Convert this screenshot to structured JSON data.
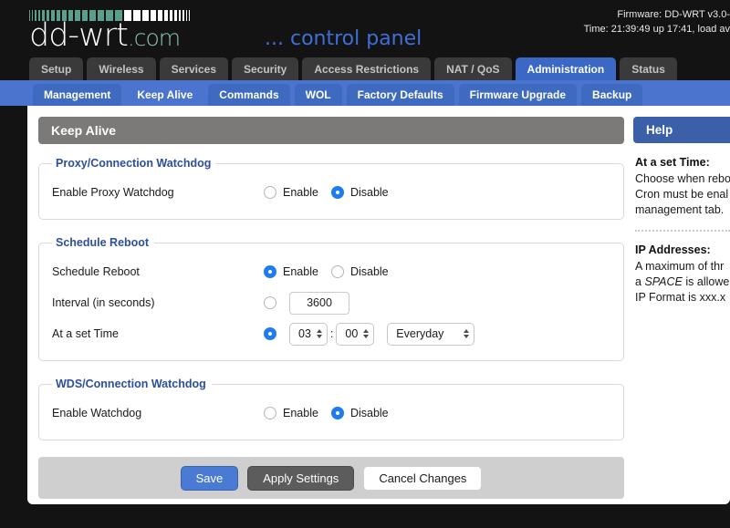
{
  "brand": {
    "logo_main": "dd-wrt",
    "logo_suffix": ".com",
    "tagline": "... control panel",
    "strip_color_teal": "#5c9e8c",
    "strip_color_white": "#ffffff"
  },
  "status": {
    "firmware_line": "Firmware: DD-WRT v3.0-",
    "time_line": "Time: 21:39:49 up 17:41, load av"
  },
  "main_tabs": [
    {
      "label": "Setup",
      "active": false
    },
    {
      "label": "Wireless",
      "active": false
    },
    {
      "label": "Services",
      "active": false
    },
    {
      "label": "Security",
      "active": false
    },
    {
      "label": "Access Restrictions",
      "active": false
    },
    {
      "label": "NAT / QoS",
      "active": false
    },
    {
      "label": "Administration",
      "active": true
    },
    {
      "label": "Status",
      "active": false
    }
  ],
  "sub_tabs": [
    {
      "label": "Management",
      "active": false
    },
    {
      "label": "Keep Alive",
      "active": true
    },
    {
      "label": "Commands",
      "active": false
    },
    {
      "label": "WOL",
      "active": false
    },
    {
      "label": "Factory Defaults",
      "active": false
    },
    {
      "label": "Firmware Upgrade",
      "active": false
    },
    {
      "label": "Backup",
      "active": false
    }
  ],
  "page_title": "Keep Alive",
  "groups": {
    "proxy": {
      "legend": "Proxy/Connection Watchdog",
      "row_label": "Enable Proxy Watchdog",
      "enable_label": "Enable",
      "disable_label": "Disable",
      "selected": "Disable"
    },
    "schedule": {
      "legend": "Schedule Reboot",
      "reboot_label": "Schedule Reboot",
      "enable_label": "Enable",
      "disable_label": "Disable",
      "reboot_selected": "Enable",
      "interval_label": "Interval (in seconds)",
      "interval_value": "3600",
      "interval_selected": false,
      "time_label": "At a set Time",
      "time_selected": true,
      "hour": "03",
      "minute": "00",
      "colon": ":",
      "day": "Everyday"
    },
    "wds": {
      "legend": "WDS/Connection Watchdog",
      "row_label": "Enable Watchdog",
      "enable_label": "Enable",
      "disable_label": "Disable",
      "selected": "Disable"
    }
  },
  "buttons": {
    "save": "Save",
    "apply": "Apply Settings",
    "cancel": "Cancel Changes"
  },
  "help": {
    "title": "Help",
    "entries": [
      {
        "heading": "At a set Time:",
        "lines": [
          "Choose when rebo",
          "Cron must be enal",
          "management tab."
        ]
      },
      {
        "heading": "IP Addresses:",
        "lines": [
          "A maximum of thr",
          "a SPACE is allowe",
          "IP Format is xxx.x"
        ]
      }
    ]
  }
}
